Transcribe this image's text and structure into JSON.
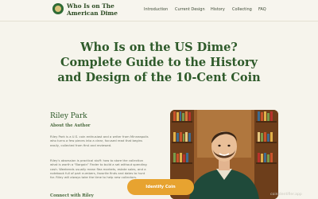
{
  "header": {
    "brand_line1": "Who Is on The",
    "brand_line2": "American Dime",
    "nav": [
      "Introduction",
      "Current Design",
      "History",
      "Collecting",
      "FAQ"
    ]
  },
  "hero": {
    "title_line1": "Who Is on the US Dime?",
    "title_line2": "Complete Guide to the History",
    "title_line3": "and Design of the 10-Cent Coin"
  },
  "author": {
    "name": "Riley Park",
    "about_label": "About the Author",
    "bio_lines": [
      "Riley Park is a U.S. coin enthusiast and a writer from Minneapolis",
      "who turns a few pieces into a clear, focused read that begins",
      "easily, collected from first and reviewed."
    ],
    "bio2_lines": [
      "Riley’s obsession is practical stuff: how to store the collection",
      "what is worth a “Bargain” Finder to build a set without spending",
      "cash. Weekends usually mean flea markets, estate sales, and a",
      "notebook full of part numbers, favorite finds and dates to hunt",
      "for. Riley will always take the time to help new collectors."
    ],
    "connect_label": "Connect with Riley"
  },
  "cta": {
    "label": "Identify Coin"
  },
  "watermark": "coinidentifier.app"
}
